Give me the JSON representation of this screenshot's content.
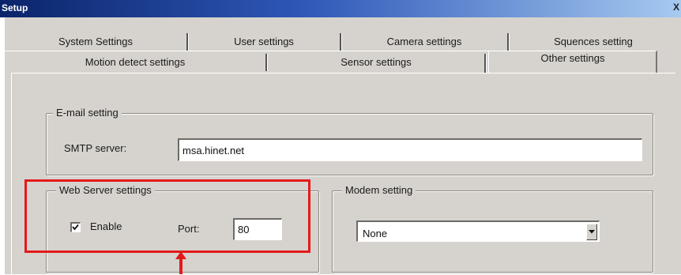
{
  "window": {
    "title": "Setup",
    "close_glyph": "X"
  },
  "tabs": {
    "row1": [
      {
        "label": "System Settings"
      },
      {
        "label": "User settings"
      },
      {
        "label": "Camera settings"
      },
      {
        "label": "Squences setting"
      }
    ],
    "row2": [
      {
        "label": "Motion detect settings"
      },
      {
        "label": "Sensor settings"
      },
      {
        "label": "Other settings",
        "active": true
      }
    ]
  },
  "email": {
    "legend": "E-mail setting",
    "smtp_label": "SMTP server:",
    "smtp_value": "msa.hinet.net"
  },
  "web_server": {
    "legend": "Web Server settings",
    "enable_label": "Enable",
    "enable_checked": true,
    "port_label": "Port:",
    "port_value": "80"
  },
  "modem": {
    "legend": "Modem setting",
    "selected": "None"
  },
  "annotation": {
    "highlight_color": "#e41a1a"
  }
}
